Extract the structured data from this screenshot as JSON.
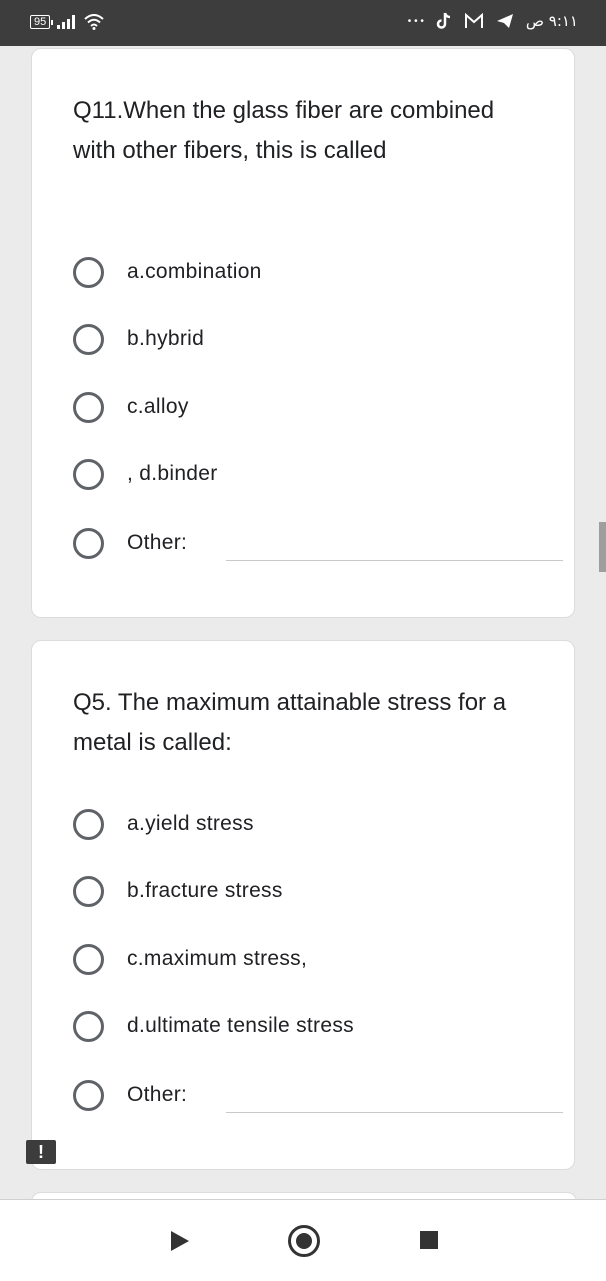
{
  "status_bar": {
    "battery": "95",
    "time": "٩:١١ ص",
    "overflow": "• • •",
    "icons": [
      "signal-icon",
      "wifi-icon",
      "tiktok-icon",
      "gmail-icon",
      "telegram-icon"
    ]
  },
  "questions": [
    {
      "title": "Q11.When the glass fiber are combined with other fibers, this is called",
      "options": [
        "a.combination",
        "b.hybrid",
        "c.alloy",
        ", d.binder",
        "Other:"
      ]
    },
    {
      "title": "Q5. The maximum attainable stress for a metal is called:",
      "options": [
        "a.yield stress",
        "b.fracture stress",
        "c.maximum stress,",
        "d.ultimate tensile stress",
        "Other:"
      ]
    }
  ],
  "notification": {
    "warning_glyph": "!"
  },
  "colors": {
    "status_bar": "#3d3d3d",
    "background": "#ebebeb",
    "card": "#ffffff",
    "radio_border": "#5f6368",
    "text": "#202124"
  }
}
